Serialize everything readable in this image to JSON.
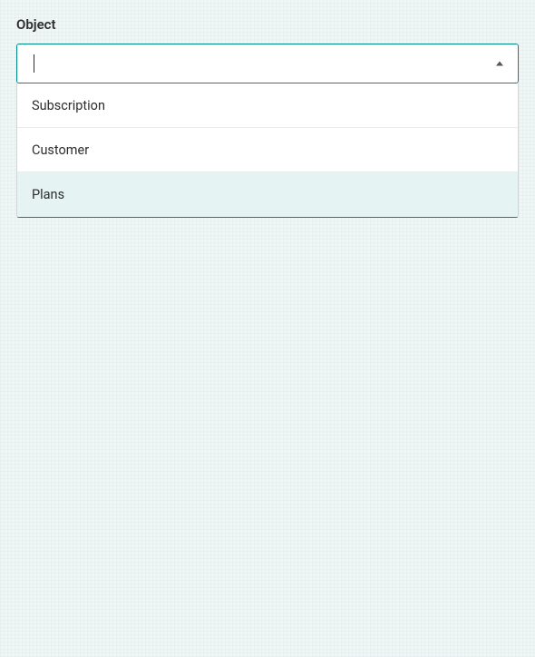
{
  "field": {
    "label": "Object",
    "value": "",
    "placeholder": ""
  },
  "dropdown": {
    "options": [
      {
        "label": "Subscription",
        "highlighted": false
      },
      {
        "label": "Customer",
        "highlighted": false
      },
      {
        "label": "Plans",
        "highlighted": true
      }
    ]
  },
  "colors": {
    "accent": "#008b8b",
    "background": "#f0f6f5",
    "text": "#2d2d2d",
    "highlight_bg": "#e6f3f3"
  }
}
